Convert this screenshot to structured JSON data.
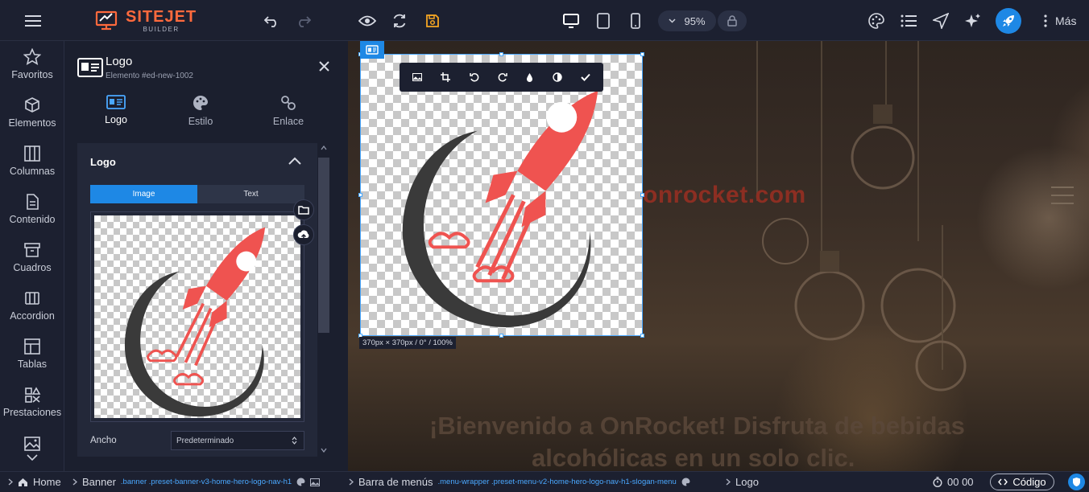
{
  "topbar": {
    "logo_title": "SITEJET",
    "logo_sub": "BUILDER",
    "zoom": "95%",
    "more_label": "Más"
  },
  "sidebar": {
    "items": [
      {
        "label": "Favoritos",
        "icon": "star-icon"
      },
      {
        "label": "Elementos",
        "icon": "cube-icon"
      },
      {
        "label": "Columnas",
        "icon": "columns-icon"
      },
      {
        "label": "Contenido",
        "icon": "document-icon"
      },
      {
        "label": "Cuadros",
        "icon": "archive-box-icon"
      },
      {
        "label": "Accordion",
        "icon": "accordion-icon"
      },
      {
        "label": "Tablas",
        "icon": "table-icon"
      },
      {
        "label": "Prestaciones",
        "icon": "shapes-icon"
      }
    ]
  },
  "panel": {
    "title": "Logo",
    "subtitle": "Elemento #ed-new-1002",
    "tabs": [
      {
        "label": "Logo",
        "icon": "id-card-icon"
      },
      {
        "label": "Estilo",
        "icon": "palette-icon"
      },
      {
        "label": "Enlace",
        "icon": "link-icon"
      }
    ],
    "section_title": "Logo",
    "segments": [
      "Image",
      "Text"
    ],
    "ancho_label": "Ancho",
    "ancho_value": "Predeterminado"
  },
  "canvas": {
    "brand_text": "onrocket.com",
    "hero_line1": "¡Bienvenido a OnRocket! Disfruta de bebidas",
    "hero_line2": "alcohólicas en un solo clic.",
    "size_badge": "370px × 370px / 0° / 100%"
  },
  "bottombar": {
    "home": "Home",
    "banner": "Banner",
    "banner_class": ".banner .preset-banner-v3-home-hero-logo-nav-h1",
    "menu": "Barra de menús",
    "menu_class": ".menu-wrapper .preset-menu-v2-home-hero-logo-nav-h1-slogan-menu",
    "logo": "Logo",
    "timer": "00 00",
    "code_label": "Código"
  },
  "colors": {
    "accent": "#1e88e5",
    "brand_orange": "#ff6a3d",
    "rocket_red": "#ef5350",
    "moon_dark": "#3a3a3a"
  }
}
